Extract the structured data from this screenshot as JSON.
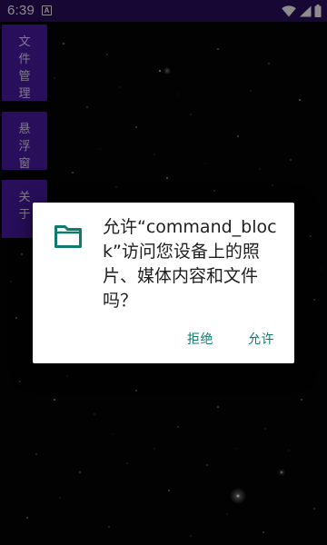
{
  "status_bar": {
    "time": "6:39",
    "notification_glyph": "A",
    "icons": [
      "wifi-icon",
      "signal-icon",
      "battery-icon"
    ]
  },
  "sidebar": {
    "items": [
      {
        "label": "文件管理",
        "chars": [
          "文",
          "件",
          "管",
          "理"
        ]
      },
      {
        "label": "悬浮窗",
        "chars": [
          "悬",
          "浮",
          "窗"
        ]
      },
      {
        "label": "关于",
        "chars": [
          "关",
          "于"
        ]
      }
    ]
  },
  "dialog": {
    "icon": "folder-icon",
    "message": "允许“command_block”访问您设备上的照片、媒体内容和文件吗？",
    "deny_label": "拒绝",
    "allow_label": "允许"
  },
  "colors": {
    "status_bar_bg": "#2a0d62",
    "sidebar_button_bg": "#4a1aa6",
    "accent": "#0f7a6e",
    "dialog_bg": "#ffffff"
  }
}
